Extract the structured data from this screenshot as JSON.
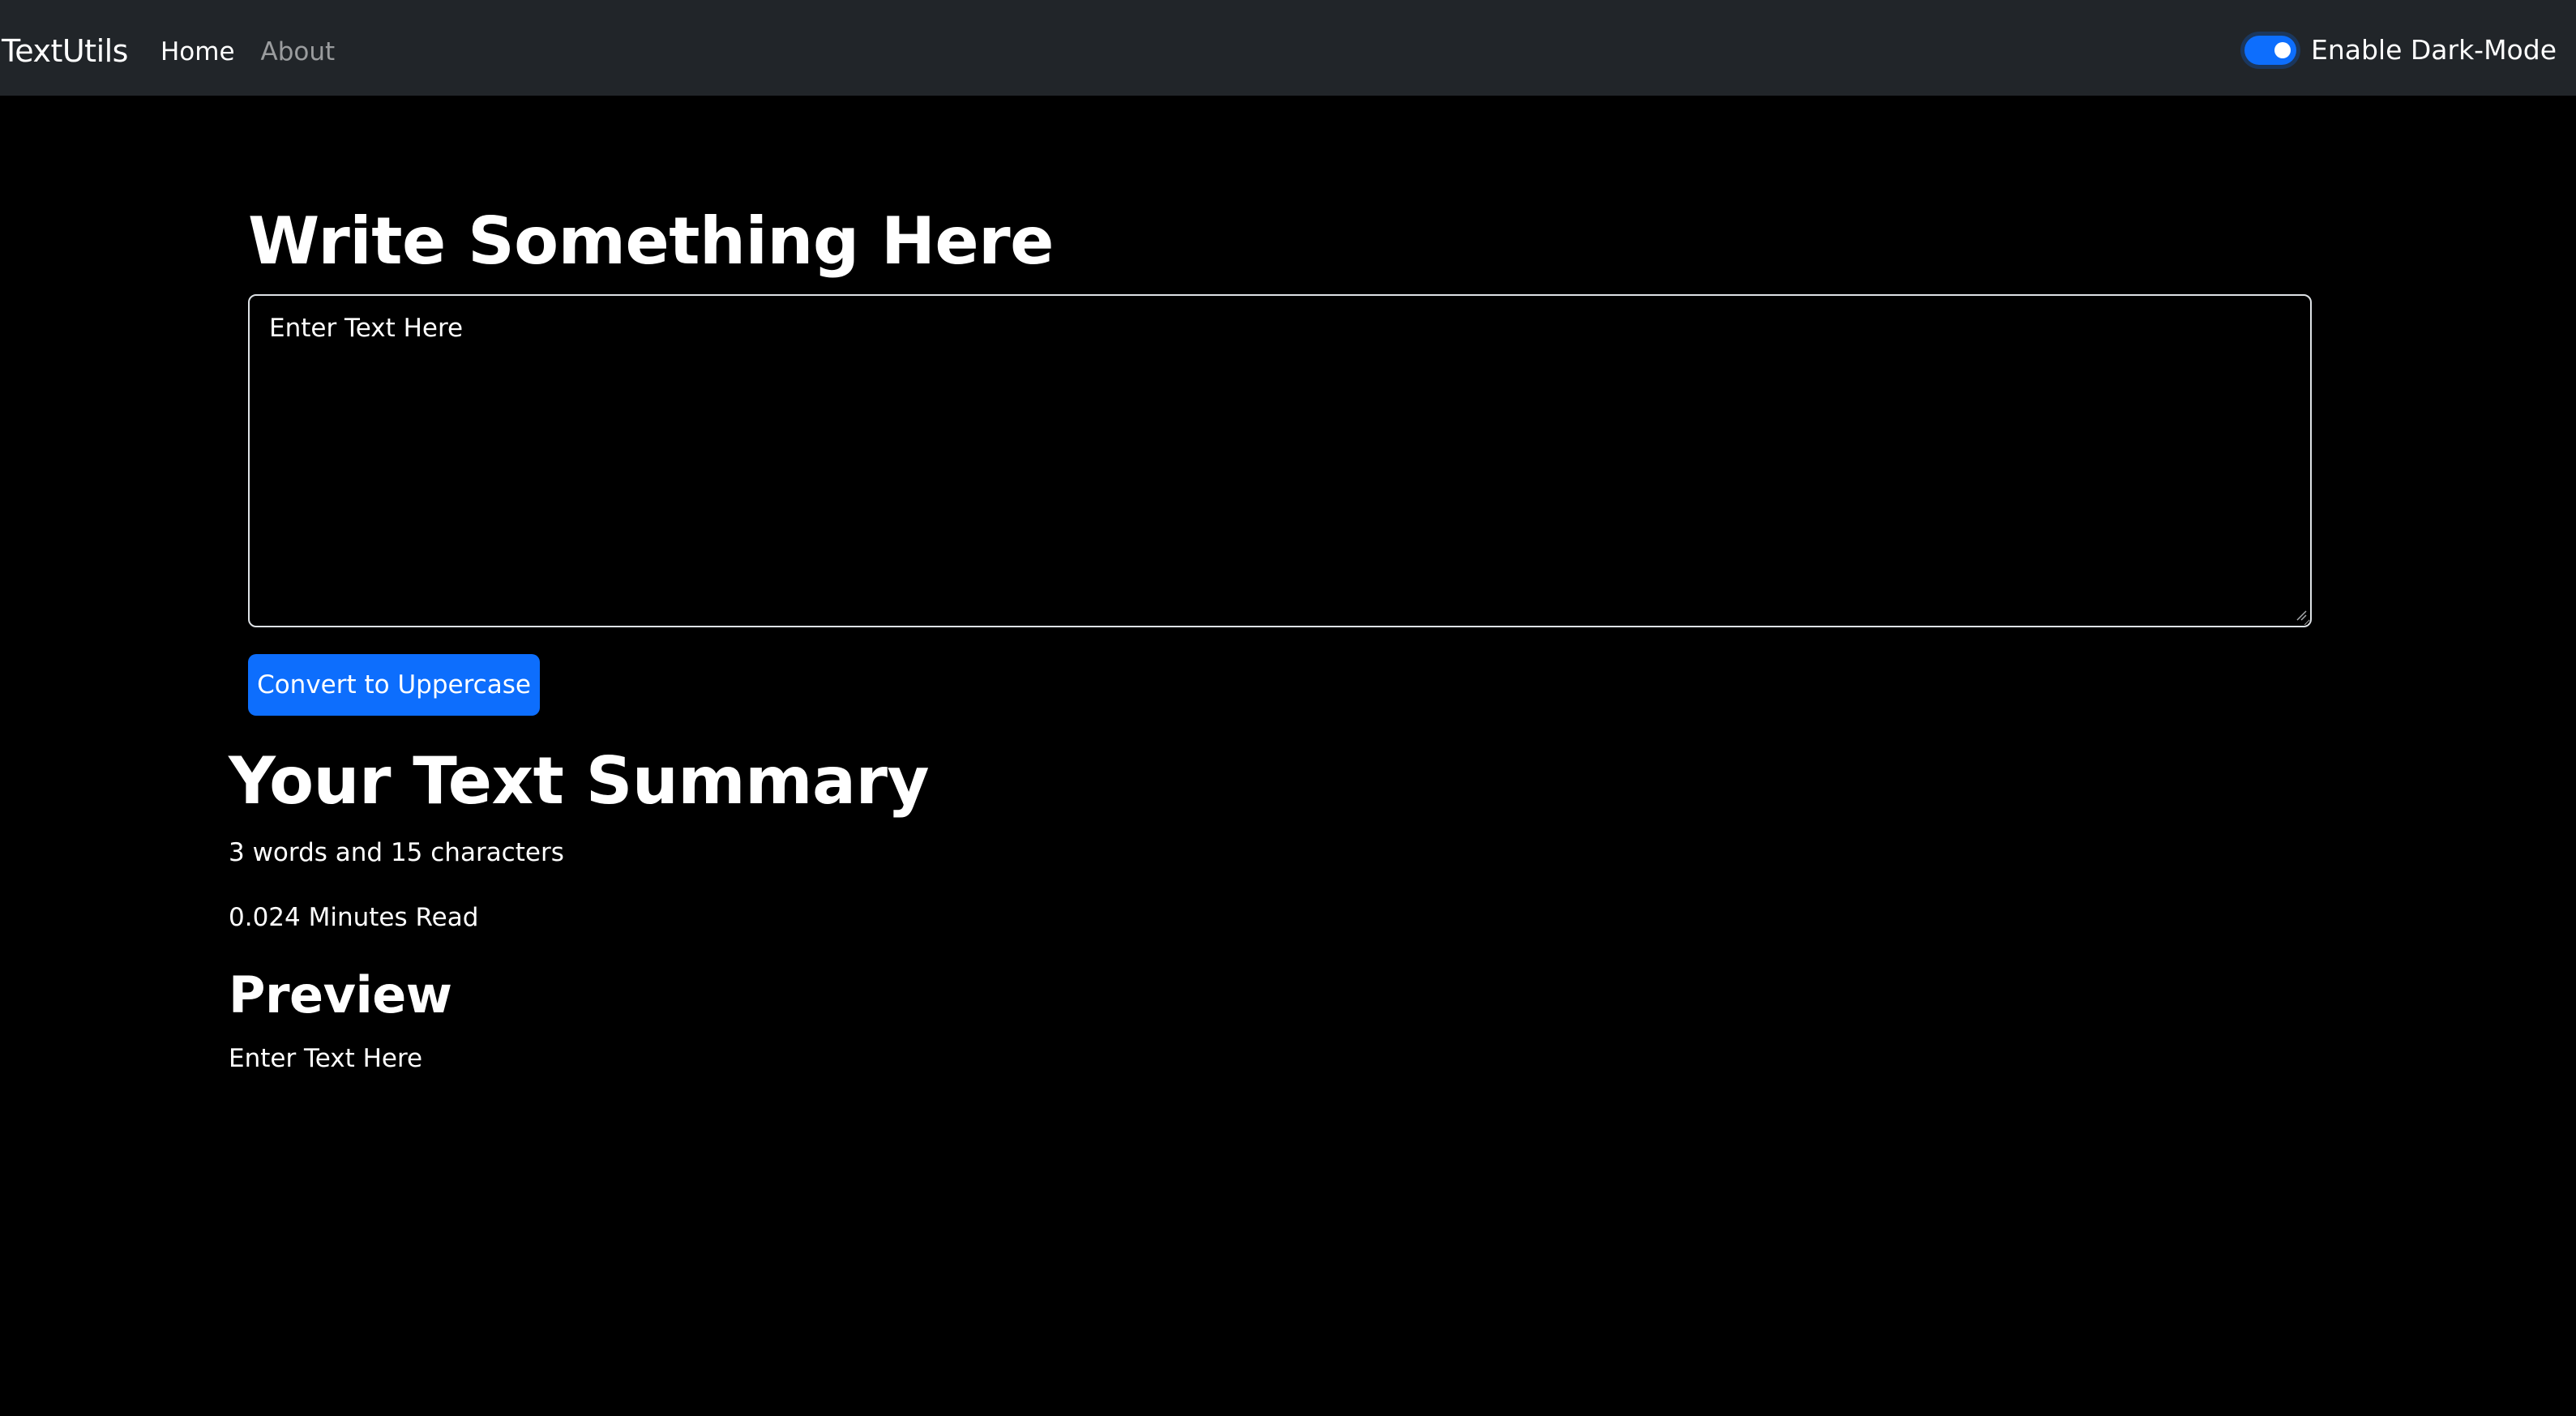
{
  "navbar": {
    "brand": "TextUtils",
    "links": [
      {
        "label": "Home",
        "active": true
      },
      {
        "label": "About",
        "active": false
      }
    ],
    "dark_mode_toggle": {
      "label": "Enable Dark-Mode",
      "checked": true
    }
  },
  "main": {
    "heading": "Write Something Here",
    "textarea": {
      "value": "",
      "placeholder": "Enter Text Here"
    },
    "convert_button_label": "Convert to Uppercase"
  },
  "summary": {
    "heading": "Your Text Summary",
    "word_char_count": "3 words and 15 characters",
    "read_time": "0.024 Minutes Read"
  },
  "preview": {
    "heading": "Preview",
    "text": "Enter Text Here"
  },
  "colors": {
    "navbar_bg": "#212529",
    "page_bg": "#000000",
    "accent": "#0d6efd",
    "text": "#ffffff"
  },
  "icons": {
    "textarea_resize": "resize-grip-icon"
  }
}
